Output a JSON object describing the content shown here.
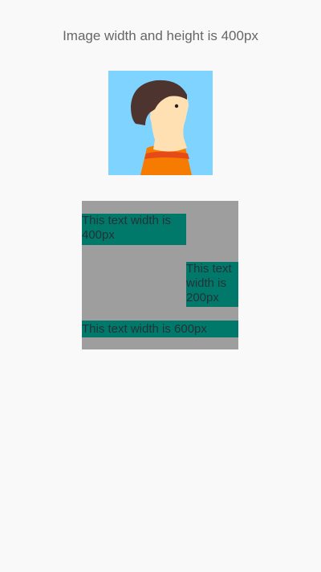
{
  "header": {
    "caption": "Image width and height is 400px"
  },
  "avatar": {
    "icon": "person-portrait-icon",
    "colors": {
      "background": "#7fd3ff",
      "hair": "#4e342e",
      "skin": "#ffe0b2",
      "shirt_primary": "#f57c00",
      "shirt_stripe": "#e64a19"
    }
  },
  "text_samples": {
    "box_color": "#9e9e9e",
    "highlight_color": "#00796b",
    "text_color": "#263238",
    "items": [
      {
        "label": "This text width is 400px"
      },
      {
        "label": "This text width is 200px"
      },
      {
        "label": "This text width is 600px"
      }
    ]
  }
}
